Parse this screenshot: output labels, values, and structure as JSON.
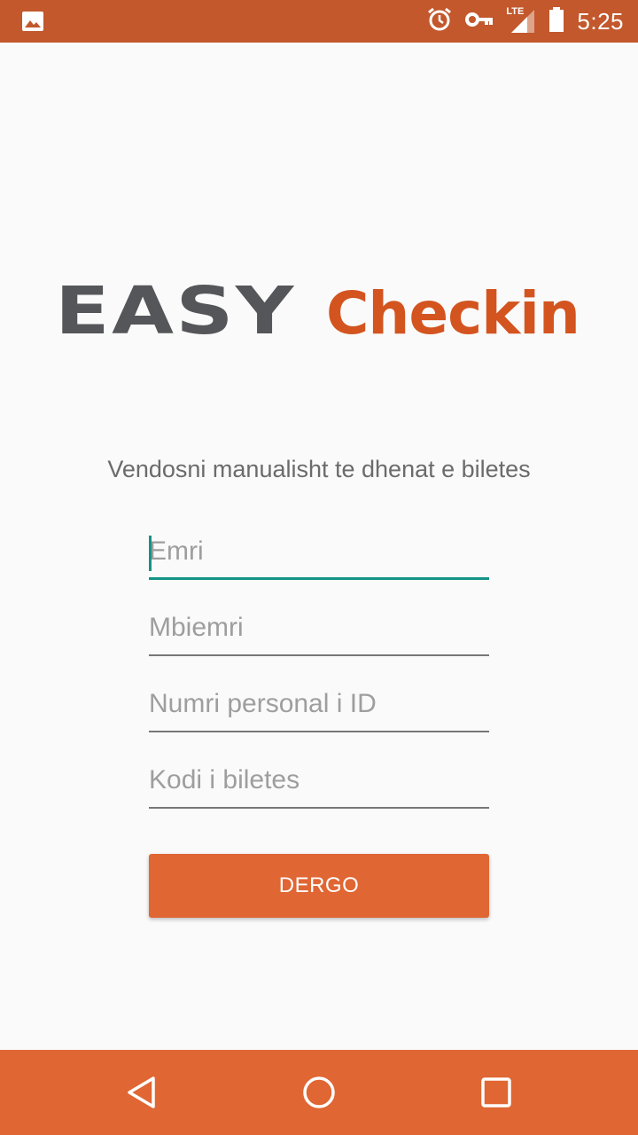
{
  "status_bar": {
    "time": "5:25",
    "network_label": "LTE",
    "icons": [
      "image-icon",
      "alarm-icon",
      "key-icon",
      "signal-icon",
      "battery-icon"
    ],
    "background": "#c2582c"
  },
  "logo": {
    "part1": "EASY",
    "part2": "Checkin",
    "part1_color": "#555659",
    "part2_color": "#d3541f"
  },
  "form": {
    "instruction": "Vendosni manualisht te dhenat e biletes",
    "fields": [
      {
        "placeholder": "Emri",
        "value": "",
        "focused": true
      },
      {
        "placeholder": "Mbiemri",
        "value": ""
      },
      {
        "placeholder": "Numri personal i ID",
        "value": ""
      },
      {
        "placeholder": "Kodi i biletes",
        "value": ""
      }
    ],
    "submit_label": "DERGO",
    "accent_color": "#159285",
    "button_color": "#e06633"
  },
  "nav_bar": {
    "buttons": [
      "back-icon",
      "home-icon",
      "recents-icon"
    ],
    "background": "#e06633"
  }
}
